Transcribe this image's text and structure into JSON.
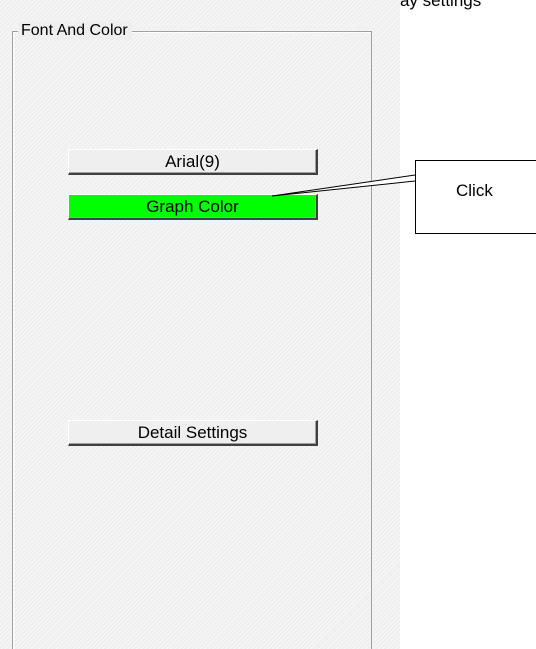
{
  "top_clipped_text": "display settings",
  "group": {
    "title": "Font And Color"
  },
  "buttons": {
    "font_label": "Arial(9)",
    "graph_color_label": "Graph Color",
    "detail_settings_label": "Detail Settings"
  },
  "annotation": {
    "callout_text": "Click"
  },
  "colors": {
    "graph_color_button": "#00ff00",
    "panel_background": "#efefef"
  }
}
